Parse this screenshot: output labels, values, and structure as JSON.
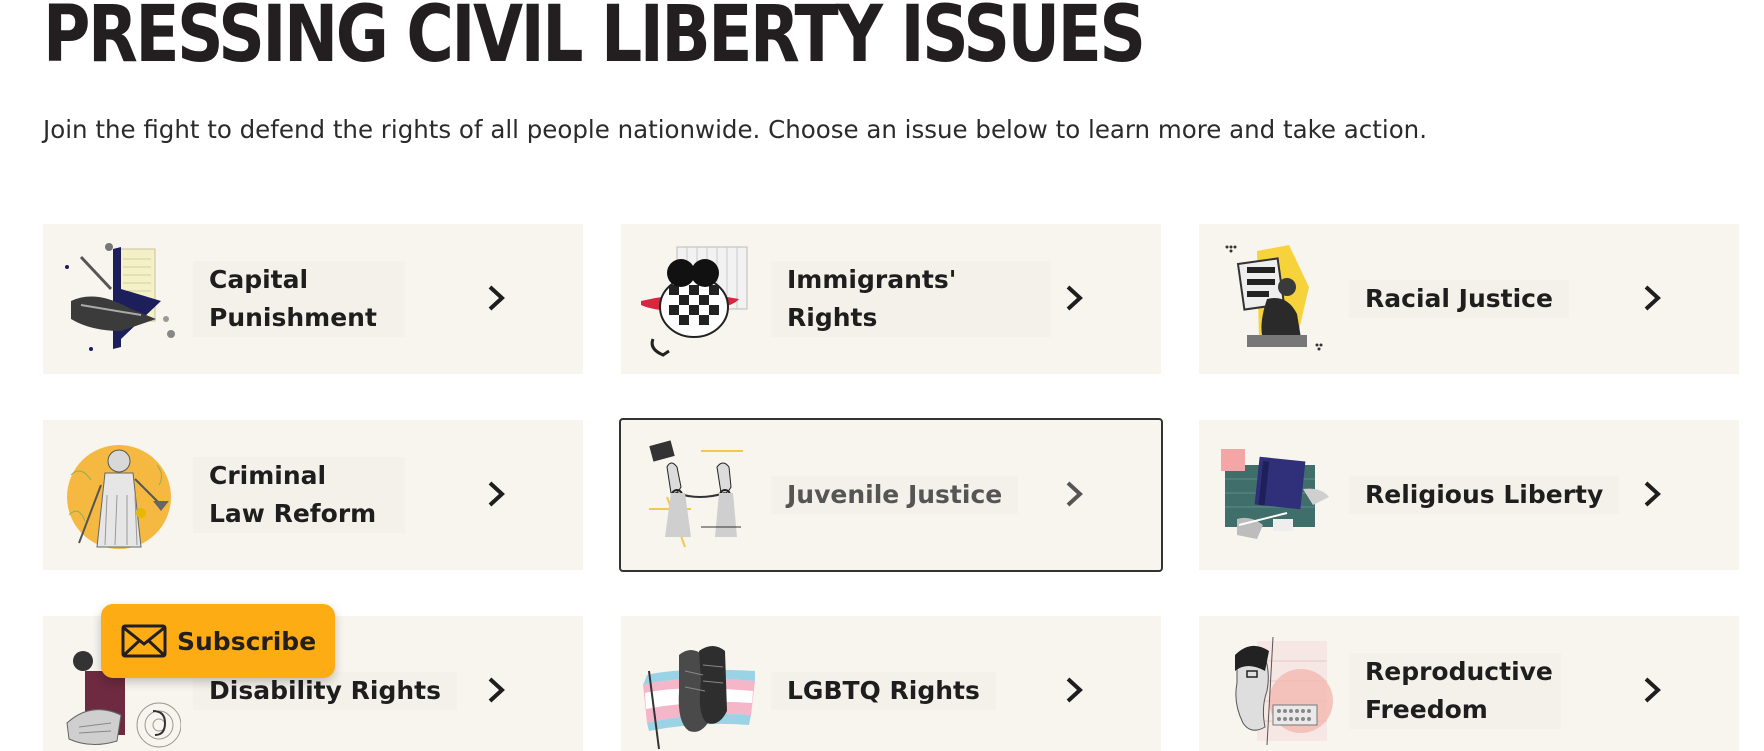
{
  "header": {
    "title": "PRESSING CIVIL LIBERTY ISSUES",
    "subtitle": "Join the fight to defend the rights of all people nationwide. Choose an issue below to learn more and take action."
  },
  "issues": [
    {
      "label": "Capital Punishment",
      "icon": "capital-punishment-collage"
    },
    {
      "label": "Immigrants' Rights",
      "icon": "immigrants-rights-collage"
    },
    {
      "label": "Racial Justice",
      "icon": "racial-justice-collage"
    },
    {
      "label": "Criminal Law Reform",
      "icon": "criminal-law-collage"
    },
    {
      "label": "Juvenile Justice",
      "icon": "juvenile-justice-collage"
    },
    {
      "label": "Religious Liberty",
      "icon": "religious-liberty-collage"
    },
    {
      "label": "Disability Rights",
      "icon": "disability-rights-collage"
    },
    {
      "label": "LGBTQ Rights",
      "icon": "lgbtq-rights-collage"
    },
    {
      "label": "Reproductive Freedom",
      "icon": "reproductive-freedom-collage"
    }
  ],
  "subscribe": {
    "label": "Subscribe",
    "icon": "envelope-icon"
  },
  "colors": {
    "card_background": "#f8f5ef",
    "subscribe_background": "#fdac14",
    "text": "#231f20",
    "focus_border": "#333333"
  }
}
